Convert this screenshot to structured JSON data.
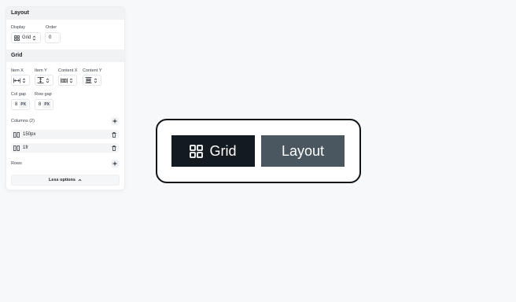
{
  "panel": {
    "layout_section": {
      "title": "Layout",
      "display_label": "Display",
      "display_value": "Grid",
      "order_label": "Order",
      "order_value": "0"
    },
    "grid_section": {
      "title": "Grid",
      "item_x_label": "Item X",
      "item_y_label": "Item Y",
      "content_x_label": "Content X",
      "content_y_label": "Content Y",
      "col_gap_label": "Col gap",
      "col_gap_value": "8",
      "col_gap_unit": "PX",
      "row_gap_label": "Row gap",
      "row_gap_value": "8",
      "row_gap_unit": "PX",
      "columns_label": "Columns (2)",
      "columns": [
        {
          "value": "150px"
        },
        {
          "value": "1fr"
        }
      ],
      "rows_label": "Rows",
      "less_options_label": "Less options"
    }
  },
  "preview": {
    "items": [
      {
        "label": "Grid",
        "icon": "grid-icon",
        "bg": "#131a20"
      },
      {
        "label": "Layout",
        "bg": "#4a5761"
      }
    ]
  }
}
